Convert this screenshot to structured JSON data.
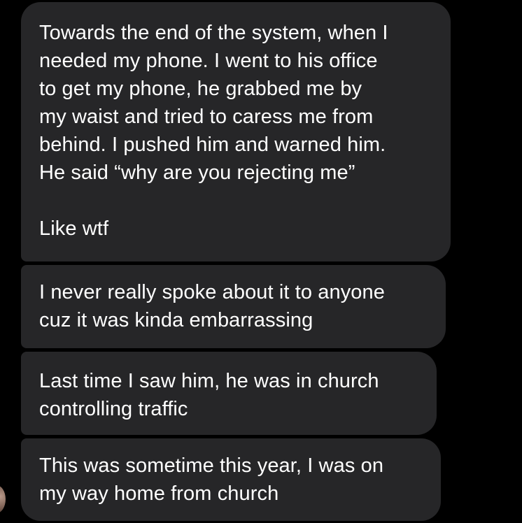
{
  "conversation": {
    "messages": [
      {
        "text": "Towards the end of the system, when I\nneeded my phone. I went to his office\nto get my phone, he grabbed me by\nmy waist and tried to caress me from\nbehind. I pushed him and warned him.\nHe said “why are you rejecting me”\n\nLike wtf"
      },
      {
        "text": "I never really spoke about it to anyone\ncuz it was kinda embarrassing"
      },
      {
        "text": "Last time I saw him, he was in church\ncontrolling traffic"
      },
      {
        "text": "This was sometime this year, I was on\nmy way home from church"
      }
    ]
  },
  "colors": {
    "background": "#000000",
    "bubble": "#262628",
    "text": "#ffffff"
  }
}
